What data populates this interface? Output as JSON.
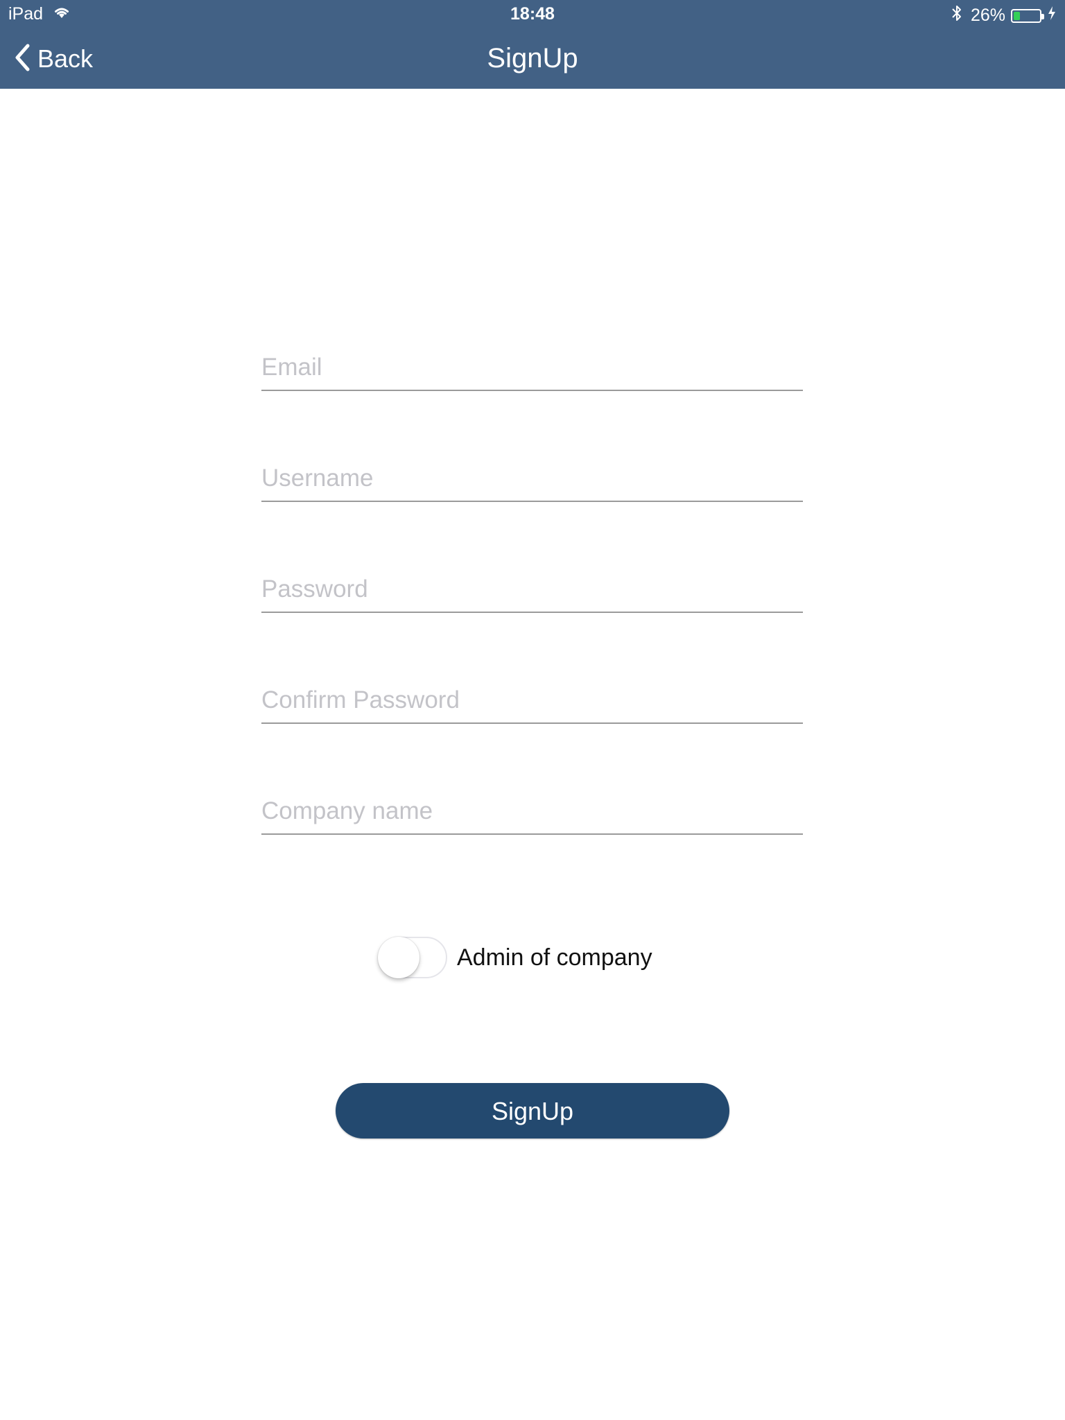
{
  "status_bar": {
    "device": "iPad",
    "time": "18:48",
    "battery_percent_text": "26%",
    "battery_level": 0.26,
    "icons": [
      "wifi-icon",
      "bluetooth-icon",
      "battery-icon",
      "charging-bolt-icon"
    ]
  },
  "nav": {
    "back_label": "Back",
    "title": "SignUp"
  },
  "form": {
    "email_placeholder": "Email",
    "username_placeholder": "Username",
    "password_placeholder": "Password",
    "confirm_password_placeholder": "Confirm Password",
    "company_name_placeholder": "Company name",
    "admin_toggle_label": "Admin of company",
    "admin_toggle_on": false,
    "submit_label": "SignUp"
  },
  "colors": {
    "nav_bg": "#426185",
    "button_bg": "#23496f",
    "placeholder": "#c3c3c8",
    "underline": "#9a9a9a",
    "battery_fill": "#34d058"
  }
}
